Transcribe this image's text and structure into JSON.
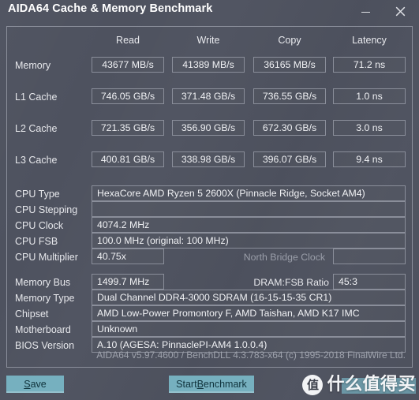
{
  "window": {
    "title": "AIDA64 Cache & Memory Benchmark",
    "minimize_icon": "minimize-icon",
    "close_icon": "close-icon"
  },
  "table": {
    "columns": [
      "Read",
      "Write",
      "Copy",
      "Latency"
    ],
    "rows": [
      {
        "label": "Memory",
        "read": "43677 MB/s",
        "write": "41389 MB/s",
        "copy": "36165 MB/s",
        "latency": "71.2 ns"
      },
      {
        "label": "L1 Cache",
        "read": "746.05 GB/s",
        "write": "371.48 GB/s",
        "copy": "736.55 GB/s",
        "latency": "1.0 ns"
      },
      {
        "label": "L2 Cache",
        "read": "721.35 GB/s",
        "write": "356.90 GB/s",
        "copy": "672.30 GB/s",
        "latency": "3.0 ns"
      },
      {
        "label": "L3 Cache",
        "read": "400.81 GB/s",
        "write": "338.98 GB/s",
        "copy": "396.07 GB/s",
        "latency": "9.4 ns"
      }
    ]
  },
  "info": {
    "cpu_type_label": "CPU Type",
    "cpu_type_value": "HexaCore AMD Ryzen 5 2600X  (Pinnacle Ridge, Socket AM4)",
    "cpu_stepping_label": "CPU Stepping",
    "cpu_stepping_value": "",
    "cpu_clock_label": "CPU Clock",
    "cpu_clock_value": "4074.2 MHz",
    "cpu_fsb_label": "CPU FSB",
    "cpu_fsb_value": "100.0 MHz  (original: 100 MHz)",
    "cpu_multiplier_label": "CPU Multiplier",
    "cpu_multiplier_value": "40.75x",
    "north_bridge_clock_label": "North Bridge Clock",
    "north_bridge_clock_value": "",
    "memory_bus_label": "Memory Bus",
    "memory_bus_value": "1499.7 MHz",
    "dram_fsb_ratio_label": "DRAM:FSB Ratio",
    "dram_fsb_ratio_value": "45:3",
    "memory_type_label": "Memory Type",
    "memory_type_value": "Dual Channel DDR4-3000 SDRAM  (16-15-15-35 CR1)",
    "chipset_label": "Chipset",
    "chipset_value": "AMD Low-Power Promontory F, AMD Taishan, AMD K17 IMC",
    "motherboard_label": "Motherboard",
    "motherboard_value": "Unknown",
    "bios_version_label": "BIOS Version",
    "bios_version_value": "A.10  (AGESA: PinnaclePI-AM4 1.0.0.4)"
  },
  "footer": {
    "credit": "AIDA64 v5.97.4600 / BenchDLL 4.3.783-x64  (c) 1995-2018 FinalWire Ltd.",
    "save_button": "Save",
    "save_button_pre": "",
    "save_button_accel": "S",
    "save_button_post": "ave",
    "benchmark_button_pre": "Start ",
    "benchmark_button_accel": "B",
    "benchmark_button_post": "enchmark"
  },
  "watermark": {
    "badge": "值",
    "text": "什么值得买"
  },
  "colors": {
    "window_bg": "#4e525f",
    "border": "#8b8f9b",
    "button": "#76b0bf",
    "text": "#e8e9ec",
    "muted_text": "#9a9ea9"
  }
}
